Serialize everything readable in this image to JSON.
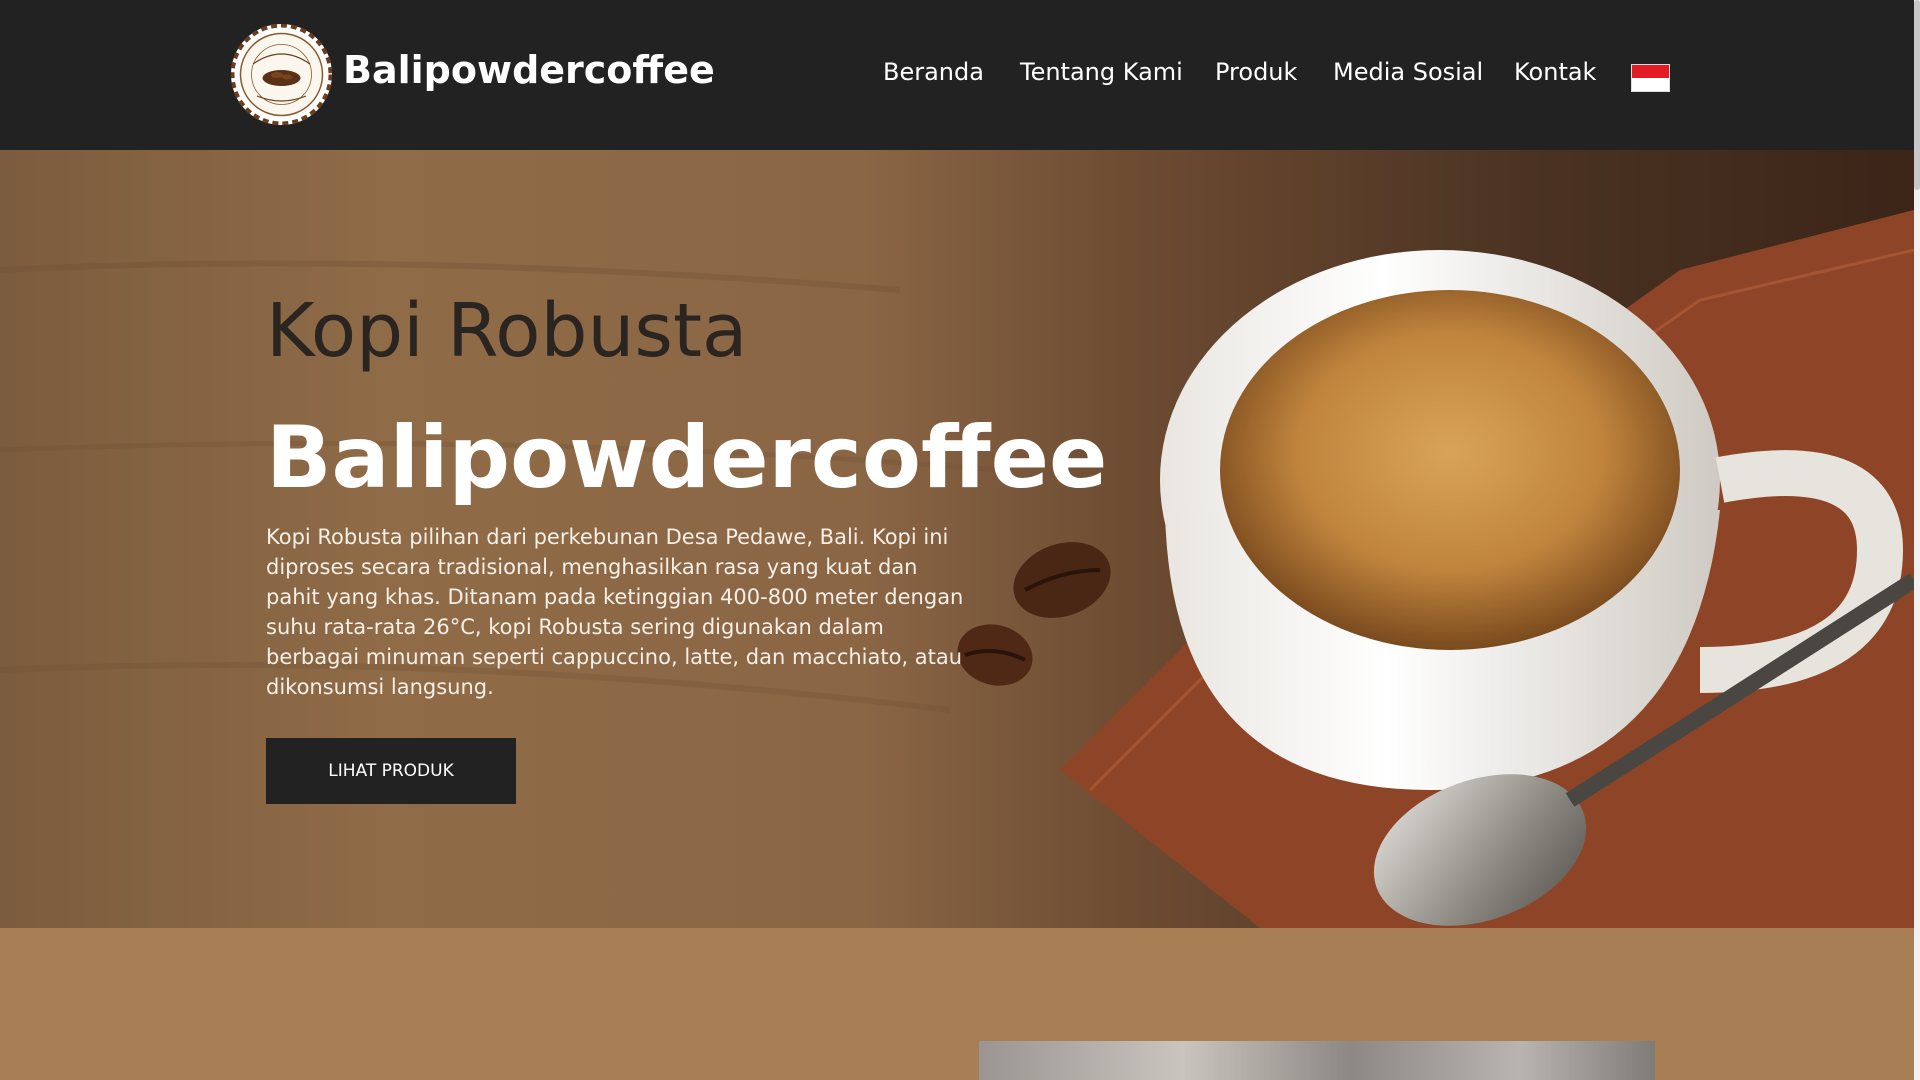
{
  "header": {
    "brand": "Balipowdercoffee",
    "logo_icon": "coffee-logo-badge",
    "nav": [
      "Beranda",
      "Tentang Kami",
      "Produk",
      "Media Sosial",
      "Kontak"
    ],
    "language_flag": "indonesia-flag-icon"
  },
  "hero": {
    "subtitle": "Kopi Robusta",
    "title": "Balipowdercoffee",
    "description": "Kopi Robusta pilihan dari perkebunan Desa Pedawe, Bali. Kopi ini diproses secara tradisional, menghasilkan rasa yang kuat dan pahit yang khas. Ditanam pada ketinggian 400-800 meter dengan suhu rata-rata 26°C, kopi Robusta sering digunakan dalam berbagai minuman seperti cappuccino, latte, dan macchiato, atau dikonsumsi langsung.",
    "button_label": "LIHAT PRODUK",
    "image": "coffee-cup-with-beans-and-spoon"
  },
  "colors": {
    "header_bg": "#222222",
    "section_bg": "#a87f55",
    "button_bg": "#222222"
  }
}
